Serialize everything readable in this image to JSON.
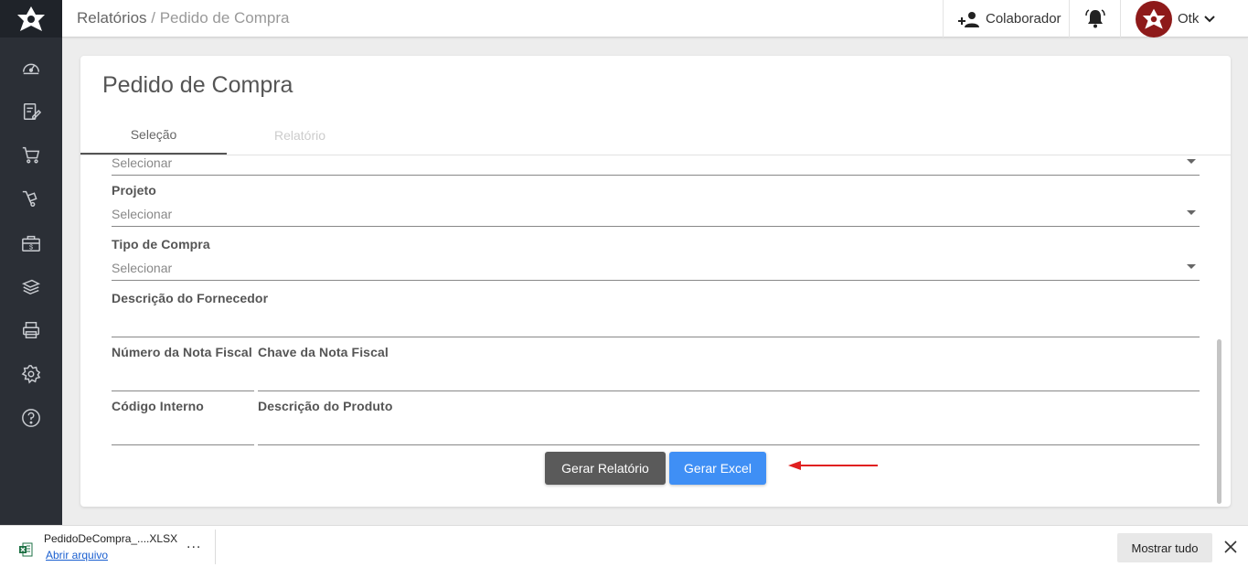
{
  "header": {
    "breadcrumb_parent": "Relatórios",
    "breadcrumb_separator": " / ",
    "breadcrumb_current": "Pedido de Compra",
    "collaborator_label": "Colaborador",
    "user_name": "Otk"
  },
  "sidebar": {
    "items": [
      {
        "icon": "dashboard-icon"
      },
      {
        "icon": "edit-document-icon"
      },
      {
        "icon": "cart-icon"
      },
      {
        "icon": "hand-truck-icon"
      },
      {
        "icon": "briefcase-money-icon"
      },
      {
        "icon": "money-stack-icon"
      },
      {
        "icon": "printer-icon"
      },
      {
        "icon": "gear-icon"
      },
      {
        "icon": "help-icon"
      }
    ]
  },
  "card": {
    "title": "Pedido de Compra",
    "tabs": [
      {
        "label": "Seleção",
        "active": true
      },
      {
        "label": "Relatório",
        "active": false
      }
    ]
  },
  "form": {
    "partial_select_value": "Selecionar",
    "projeto": {
      "label": "Projeto",
      "value": "Selecionar"
    },
    "tipo_compra": {
      "label": "Tipo de Compra",
      "value": "Selecionar"
    },
    "descricao_fornecedor": {
      "label": "Descrição do Fornecedor"
    },
    "numero_nota": {
      "label": "Número da Nota Fiscal"
    },
    "chave_nota": {
      "label": "Chave da Nota Fiscal"
    },
    "codigo_interno": {
      "label": "Código Interno"
    },
    "descricao_produto": {
      "label": "Descrição do Produto"
    }
  },
  "buttons": {
    "gerar_relatorio": "Gerar Relatório",
    "gerar_excel": "Gerar Excel"
  },
  "colors": {
    "sidebar": "#2b2f36",
    "primary_button": "#3f8ff5",
    "secondary_button": "#5a5a5a",
    "annotation_arrow": "#e02020",
    "avatar": "#8e1a1a"
  },
  "download_bar": {
    "file_name": "PedidoDeCompra_....XLSX",
    "open_label": "Abrir arquivo",
    "more_label": "...",
    "show_all_label": "Mostrar tudo"
  }
}
